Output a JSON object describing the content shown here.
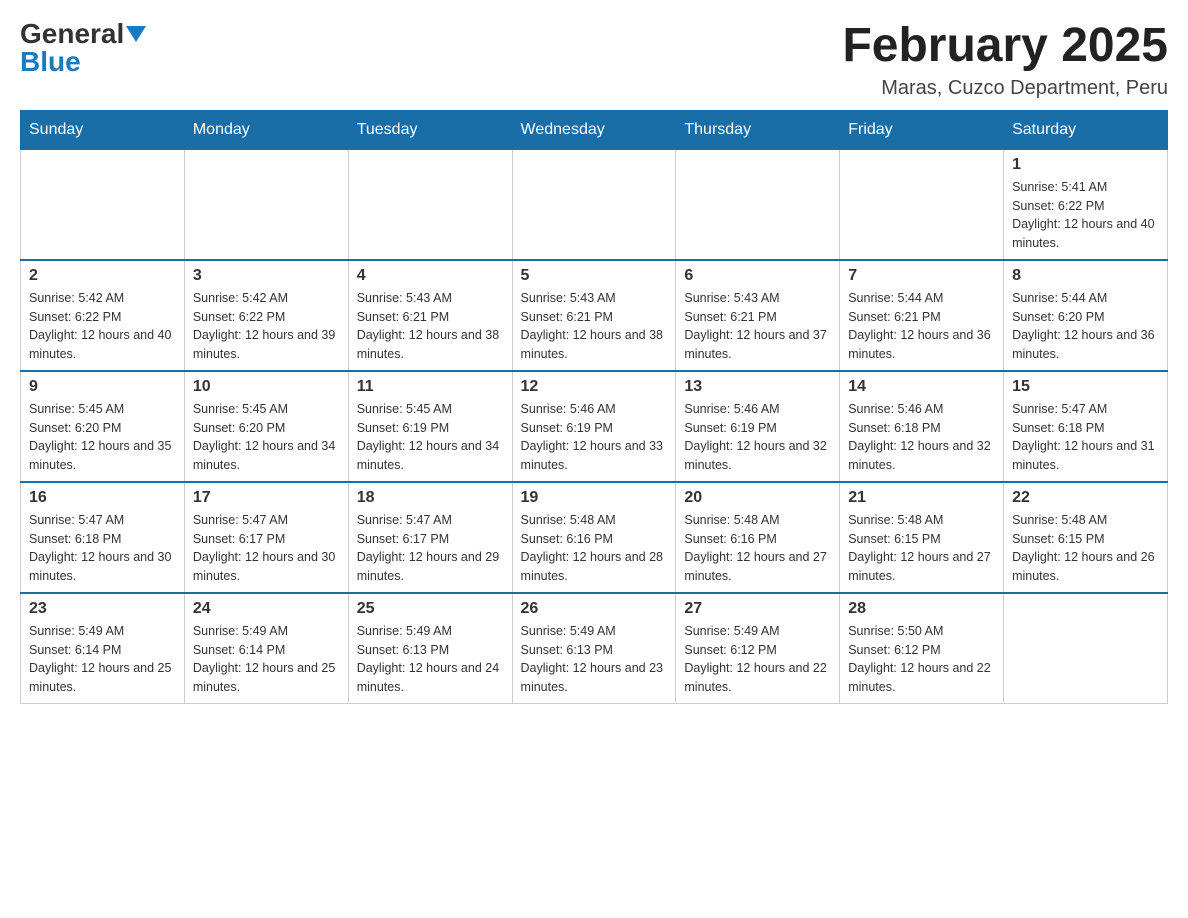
{
  "logo": {
    "general": "General",
    "blue": "Blue"
  },
  "title": "February 2025",
  "subtitle": "Maras, Cuzco Department, Peru",
  "weekdays": [
    "Sunday",
    "Monday",
    "Tuesday",
    "Wednesday",
    "Thursday",
    "Friday",
    "Saturday"
  ],
  "weeks": [
    [
      null,
      null,
      null,
      null,
      null,
      null,
      {
        "day": "1",
        "sunrise": "Sunrise: 5:41 AM",
        "sunset": "Sunset: 6:22 PM",
        "daylight": "Daylight: 12 hours and 40 minutes."
      }
    ],
    [
      {
        "day": "2",
        "sunrise": "Sunrise: 5:42 AM",
        "sunset": "Sunset: 6:22 PM",
        "daylight": "Daylight: 12 hours and 40 minutes."
      },
      {
        "day": "3",
        "sunrise": "Sunrise: 5:42 AM",
        "sunset": "Sunset: 6:22 PM",
        "daylight": "Daylight: 12 hours and 39 minutes."
      },
      {
        "day": "4",
        "sunrise": "Sunrise: 5:43 AM",
        "sunset": "Sunset: 6:21 PM",
        "daylight": "Daylight: 12 hours and 38 minutes."
      },
      {
        "day": "5",
        "sunrise": "Sunrise: 5:43 AM",
        "sunset": "Sunset: 6:21 PM",
        "daylight": "Daylight: 12 hours and 38 minutes."
      },
      {
        "day": "6",
        "sunrise": "Sunrise: 5:43 AM",
        "sunset": "Sunset: 6:21 PM",
        "daylight": "Daylight: 12 hours and 37 minutes."
      },
      {
        "day": "7",
        "sunrise": "Sunrise: 5:44 AM",
        "sunset": "Sunset: 6:21 PM",
        "daylight": "Daylight: 12 hours and 36 minutes."
      },
      {
        "day": "8",
        "sunrise": "Sunrise: 5:44 AM",
        "sunset": "Sunset: 6:20 PM",
        "daylight": "Daylight: 12 hours and 36 minutes."
      }
    ],
    [
      {
        "day": "9",
        "sunrise": "Sunrise: 5:45 AM",
        "sunset": "Sunset: 6:20 PM",
        "daylight": "Daylight: 12 hours and 35 minutes."
      },
      {
        "day": "10",
        "sunrise": "Sunrise: 5:45 AM",
        "sunset": "Sunset: 6:20 PM",
        "daylight": "Daylight: 12 hours and 34 minutes."
      },
      {
        "day": "11",
        "sunrise": "Sunrise: 5:45 AM",
        "sunset": "Sunset: 6:19 PM",
        "daylight": "Daylight: 12 hours and 34 minutes."
      },
      {
        "day": "12",
        "sunrise": "Sunrise: 5:46 AM",
        "sunset": "Sunset: 6:19 PM",
        "daylight": "Daylight: 12 hours and 33 minutes."
      },
      {
        "day": "13",
        "sunrise": "Sunrise: 5:46 AM",
        "sunset": "Sunset: 6:19 PM",
        "daylight": "Daylight: 12 hours and 32 minutes."
      },
      {
        "day": "14",
        "sunrise": "Sunrise: 5:46 AM",
        "sunset": "Sunset: 6:18 PM",
        "daylight": "Daylight: 12 hours and 32 minutes."
      },
      {
        "day": "15",
        "sunrise": "Sunrise: 5:47 AM",
        "sunset": "Sunset: 6:18 PM",
        "daylight": "Daylight: 12 hours and 31 minutes."
      }
    ],
    [
      {
        "day": "16",
        "sunrise": "Sunrise: 5:47 AM",
        "sunset": "Sunset: 6:18 PM",
        "daylight": "Daylight: 12 hours and 30 minutes."
      },
      {
        "day": "17",
        "sunrise": "Sunrise: 5:47 AM",
        "sunset": "Sunset: 6:17 PM",
        "daylight": "Daylight: 12 hours and 30 minutes."
      },
      {
        "day": "18",
        "sunrise": "Sunrise: 5:47 AM",
        "sunset": "Sunset: 6:17 PM",
        "daylight": "Daylight: 12 hours and 29 minutes."
      },
      {
        "day": "19",
        "sunrise": "Sunrise: 5:48 AM",
        "sunset": "Sunset: 6:16 PM",
        "daylight": "Daylight: 12 hours and 28 minutes."
      },
      {
        "day": "20",
        "sunrise": "Sunrise: 5:48 AM",
        "sunset": "Sunset: 6:16 PM",
        "daylight": "Daylight: 12 hours and 27 minutes."
      },
      {
        "day": "21",
        "sunrise": "Sunrise: 5:48 AM",
        "sunset": "Sunset: 6:15 PM",
        "daylight": "Daylight: 12 hours and 27 minutes."
      },
      {
        "day": "22",
        "sunrise": "Sunrise: 5:48 AM",
        "sunset": "Sunset: 6:15 PM",
        "daylight": "Daylight: 12 hours and 26 minutes."
      }
    ],
    [
      {
        "day": "23",
        "sunrise": "Sunrise: 5:49 AM",
        "sunset": "Sunset: 6:14 PM",
        "daylight": "Daylight: 12 hours and 25 minutes."
      },
      {
        "day": "24",
        "sunrise": "Sunrise: 5:49 AM",
        "sunset": "Sunset: 6:14 PM",
        "daylight": "Daylight: 12 hours and 25 minutes."
      },
      {
        "day": "25",
        "sunrise": "Sunrise: 5:49 AM",
        "sunset": "Sunset: 6:13 PM",
        "daylight": "Daylight: 12 hours and 24 minutes."
      },
      {
        "day": "26",
        "sunrise": "Sunrise: 5:49 AM",
        "sunset": "Sunset: 6:13 PM",
        "daylight": "Daylight: 12 hours and 23 minutes."
      },
      {
        "day": "27",
        "sunrise": "Sunrise: 5:49 AM",
        "sunset": "Sunset: 6:12 PM",
        "daylight": "Daylight: 12 hours and 22 minutes."
      },
      {
        "day": "28",
        "sunrise": "Sunrise: 5:50 AM",
        "sunset": "Sunset: 6:12 PM",
        "daylight": "Daylight: 12 hours and 22 minutes."
      },
      null
    ]
  ]
}
